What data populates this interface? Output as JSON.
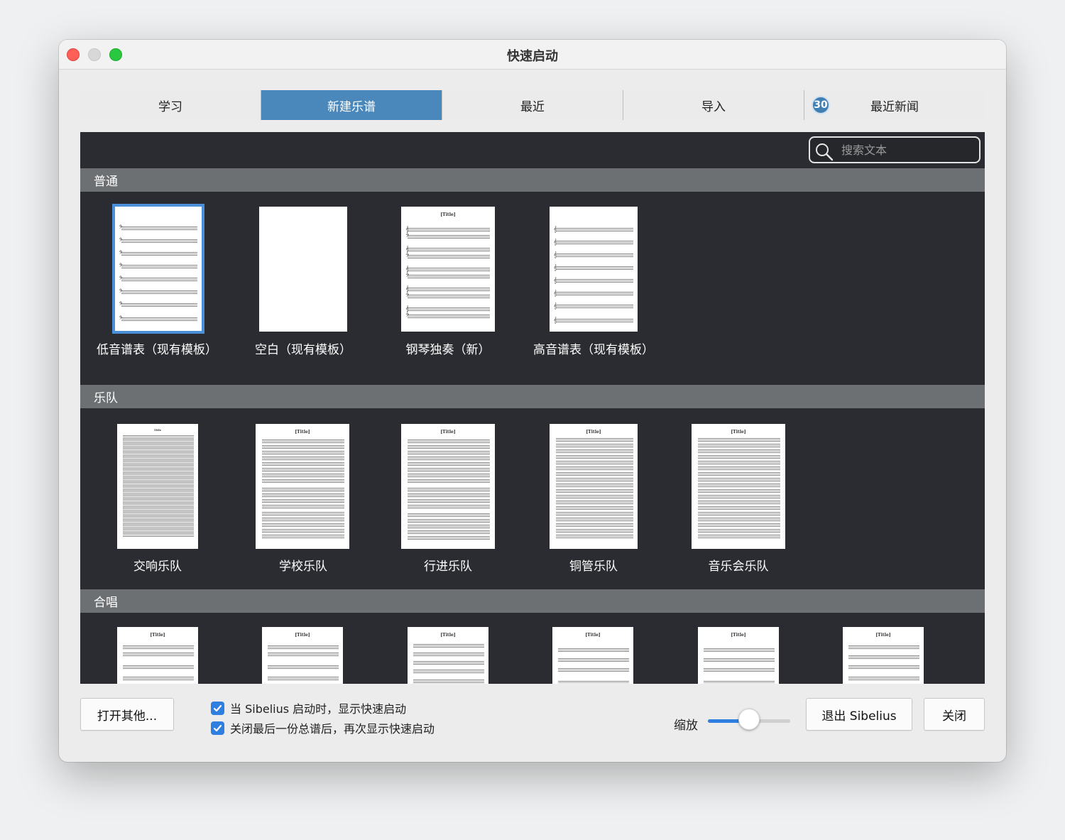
{
  "window": {
    "title": "快速启动"
  },
  "tabs": [
    {
      "label": "学习"
    },
    {
      "label": "新建乐谱",
      "active": true
    },
    {
      "label": "最近"
    },
    {
      "label": "导入"
    },
    {
      "label": "最近新闻",
      "badge": "30"
    }
  ],
  "search": {
    "placeholder": "搜索文本"
  },
  "sections": [
    {
      "title": "普通",
      "items": [
        {
          "label": "低音谱表（现有模板）",
          "selected": true
        },
        {
          "label": "空白（现有模板）"
        },
        {
          "label": "钢琴独奏（新）"
        },
        {
          "label": "高音谱表（现有模板）"
        }
      ]
    },
    {
      "title": "乐队",
      "items": [
        {
          "label": "交响乐队"
        },
        {
          "label": "学校乐队"
        },
        {
          "label": "行进乐队"
        },
        {
          "label": "铜管乐队"
        },
        {
          "label": "音乐会乐队"
        }
      ]
    },
    {
      "title": "合唱",
      "items": []
    }
  ],
  "footer": {
    "open_other": "打开其他...",
    "check1": "当 Sibelius 启动时，显示快速启动",
    "check2": "关闭最后一份总谱后，再次显示快速启动",
    "zoom_label": "缩放",
    "zoom_value": 0.5,
    "quit": "退出 Sibelius",
    "close": "关闭"
  },
  "colors": {
    "accent": "#4a88bb",
    "panel_bg": "#2b2c31",
    "section_bg": "#6d7073",
    "checkbox": "#2f7fe0"
  }
}
